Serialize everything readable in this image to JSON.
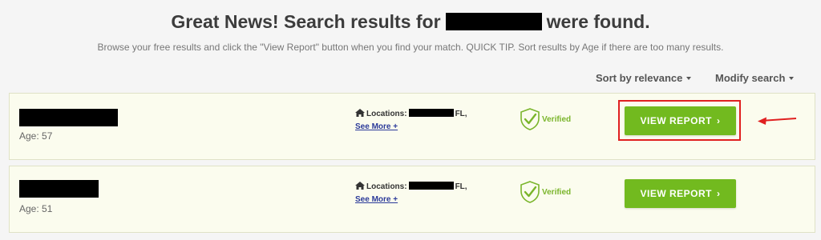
{
  "header": {
    "headline_before": "Great News! Search results for",
    "headline_after": "were found.",
    "subtext": "Browse your free results and click the \"View Report\" button when you find your match. QUICK TIP. Sort results by Age if there are too many results."
  },
  "toolbar": {
    "sort_label": "Sort by relevance",
    "modify_label": "Modify search"
  },
  "results": [
    {
      "age": "Age: 57",
      "locations_label": "Locations:",
      "state": "FL,",
      "see_more": "See More +",
      "verified": "Verified",
      "button_label": "VIEW REPORT"
    },
    {
      "age": "Age: 51",
      "locations_label": "Locations:",
      "state": "FL,",
      "see_more": "See More +",
      "verified": "Verified",
      "button_label": "VIEW REPORT"
    }
  ],
  "icons": {
    "home": "home-icon",
    "verified": "shield-check-icon",
    "chevron": "chevron-right-icon",
    "caret": "caret-down-icon",
    "arrow": "arrow-left-icon"
  },
  "colors": {
    "accent_green": "#72ba1f",
    "verified_green": "#7ab52b",
    "highlight_red": "#e02020",
    "link_blue": "#2b3a99",
    "card_bg": "#fbfcee"
  }
}
